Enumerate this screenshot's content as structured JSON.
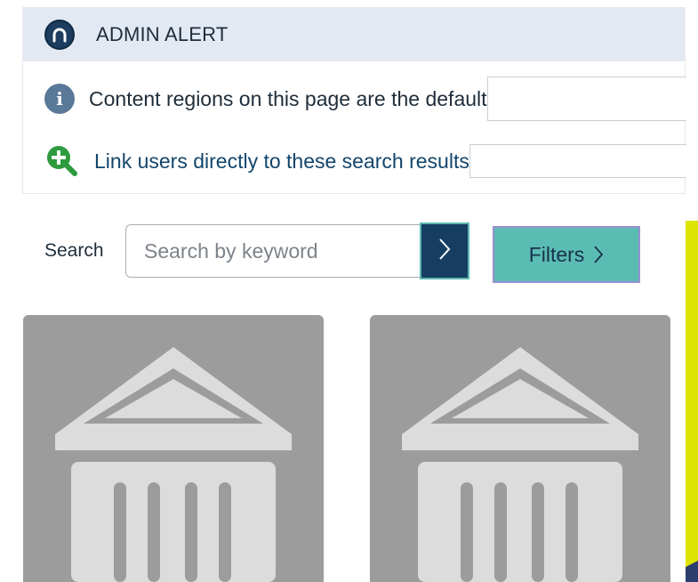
{
  "admin_alert": {
    "title": "ADMIN ALERT",
    "logo_letter": "n",
    "notices": [
      {
        "icon": "info-icon",
        "text": "Content regions on this page are the default"
      },
      {
        "icon": "zoom-in-icon",
        "text": "Link users directly to these search results"
      }
    ]
  },
  "search": {
    "label": "Search",
    "placeholder": "Search by keyword",
    "submit_icon": "chevron-right-icon"
  },
  "filters": {
    "label": "Filters",
    "icon": "chevron-right-icon"
  },
  "results": [
    {
      "image_icon": "institution-building-icon"
    },
    {
      "image_icon": "institution-building-icon"
    }
  ],
  "colors": {
    "alert_header_bg": "#e3e9f3",
    "primary_navy": "#163e62",
    "filters_teal": "#5bbcb4",
    "card_placeholder_gray": "#9c9c9c",
    "accent_yellow": "#dde400",
    "zoom_icon_green": "#2e9b3e"
  }
}
